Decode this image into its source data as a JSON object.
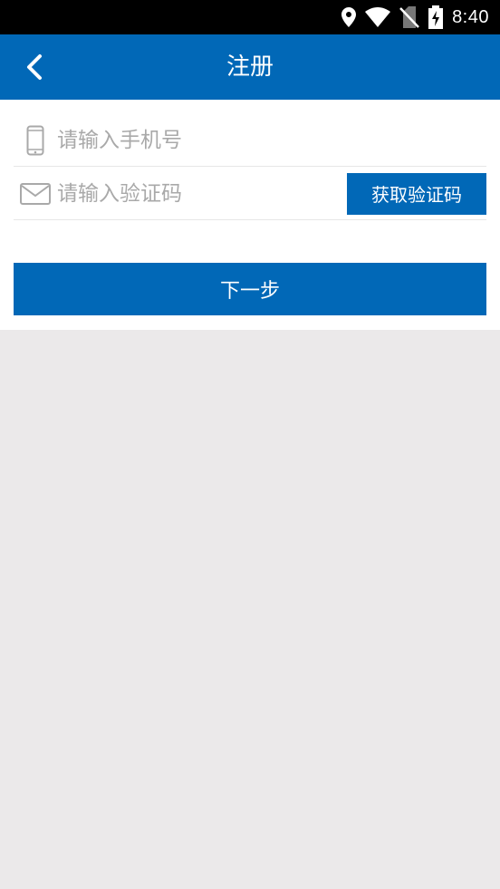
{
  "status_bar": {
    "time": "8:40",
    "icons": [
      "location-icon",
      "wifi-icon",
      "no-sim-icon",
      "battery-charging-icon"
    ]
  },
  "app_bar": {
    "back_icon": "chevron-left-icon",
    "title": "注册"
  },
  "form": {
    "phone": {
      "icon": "phone-icon",
      "value": "",
      "placeholder": "请输入手机号"
    },
    "code": {
      "icon": "mail-icon",
      "value": "",
      "placeholder": "请输入验证码"
    },
    "get_code_label": "获取验证码",
    "next_label": "下一步"
  },
  "colors": {
    "primary": "#0168b7",
    "background": "#ebe9ea",
    "placeholder": "#a9a9a9"
  }
}
